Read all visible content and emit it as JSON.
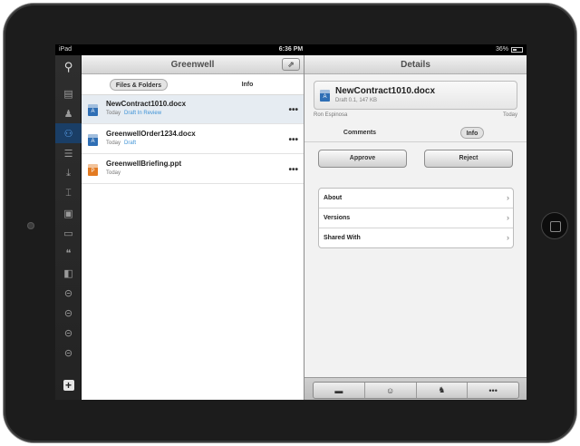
{
  "statusbar": {
    "device": "iPad",
    "time": "6:36 PM",
    "battery": "36%"
  },
  "rail": {
    "items": [
      {
        "name": "search-icon",
        "glyph": "⚲"
      },
      {
        "name": "newspaper-icon",
        "glyph": "▤"
      },
      {
        "name": "person-icon",
        "glyph": "♟"
      },
      {
        "name": "people-icon",
        "glyph": "⚇"
      },
      {
        "name": "stack-icon",
        "glyph": "☰"
      },
      {
        "name": "inbox-icon",
        "glyph": "⤓"
      },
      {
        "name": "type-icon",
        "glyph": "⌶"
      },
      {
        "name": "briefcase-icon",
        "glyph": "▣"
      },
      {
        "name": "comment-icon",
        "glyph": "▭"
      },
      {
        "name": "quote-icon",
        "glyph": "❝"
      },
      {
        "name": "bookmark-icon",
        "glyph": "◧"
      },
      {
        "name": "signin-icon",
        "glyph": "⊝"
      },
      {
        "name": "signin-icon",
        "glyph": "⊝"
      },
      {
        "name": "signin-icon",
        "glyph": "⊝"
      },
      {
        "name": "signin-icon",
        "glyph": "⊝"
      },
      {
        "name": "add-icon",
        "glyph": "+"
      }
    ]
  },
  "files_pane": {
    "title": "Greenwell",
    "share_icon": "⇗",
    "tabs": [
      "Files & Folders",
      "Info"
    ],
    "files": [
      {
        "name": "NewContract1010.docx",
        "date": "Today",
        "status": "Draft In Review",
        "type": "docx"
      },
      {
        "name": "GreenwellOrder1234.docx",
        "date": "Today",
        "status": "Draft",
        "type": "docx"
      },
      {
        "name": "GreenwellBriefing.ppt",
        "date": "Today",
        "status": "",
        "type": "ppt"
      }
    ],
    "more": "•••"
  },
  "details_pane": {
    "title": "Details",
    "doc_title": "NewContract1010.docx",
    "doc_sub": "Draft 0.1, 147 KB",
    "owner": "Ron Espinosa",
    "owner_date": "Today",
    "tabs": [
      "Comments",
      "Info"
    ],
    "approve": "Approve",
    "reject": "Reject",
    "info_rows": [
      "About",
      "Versions",
      "Shared With"
    ],
    "chevron": "›",
    "toolbar": [
      "▬",
      "☺",
      "♞",
      "•••"
    ]
  }
}
